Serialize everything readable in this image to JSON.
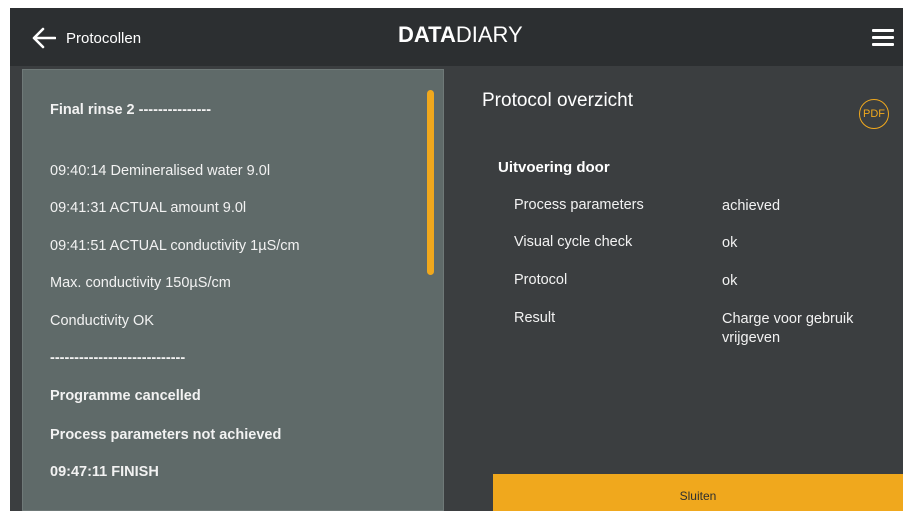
{
  "header": {
    "back_label": "Protocollen",
    "brand_bold": "DATA",
    "brand_light": "DIARY",
    "back_icon": "arrow-left-icon",
    "menu_icon": "hamburger-menu-icon"
  },
  "log": {
    "lines": [
      {
        "text": "Final rinse 2 ---------------",
        "bold": true
      },
      {
        "text": "09:40:14 Demineralised water 9.0l",
        "bold": false
      },
      {
        "text": "09:41:31 ACTUAL amount 9.0l",
        "bold": false
      },
      {
        "text": "09:41:51 ACTUAL conductivity 1µS/cm",
        "bold": false
      },
      {
        "text": "Max. conductivity 150µS/cm",
        "bold": false
      },
      {
        "text": "Conductivity OK",
        "bold": false
      },
      {
        "text": "----------------------------",
        "bold": true
      },
      {
        "text": "Programme cancelled",
        "bold": true
      },
      {
        "text": "Process parameters not achieved",
        "bold": true
      },
      {
        "text": "09:47:11 FINISH",
        "bold": true
      }
    ]
  },
  "overview": {
    "title": "Protocol overzicht",
    "pdf_label": "PDF",
    "section_heading": "Uitvoering door",
    "rows": [
      {
        "label": "Process parameters",
        "value": "achieved"
      },
      {
        "label": "Visual cycle check",
        "value": "ok"
      },
      {
        "label": "Protocol",
        "value": "ok"
      },
      {
        "label": "Result",
        "value": "Charge voor gebruik vrijgeven"
      }
    ],
    "close_label": "Sluiten"
  },
  "colors": {
    "accent": "#f0a81d",
    "topbar": "#2c2f31",
    "background": "#3b3e40",
    "log_panel": "#5f6a69"
  }
}
